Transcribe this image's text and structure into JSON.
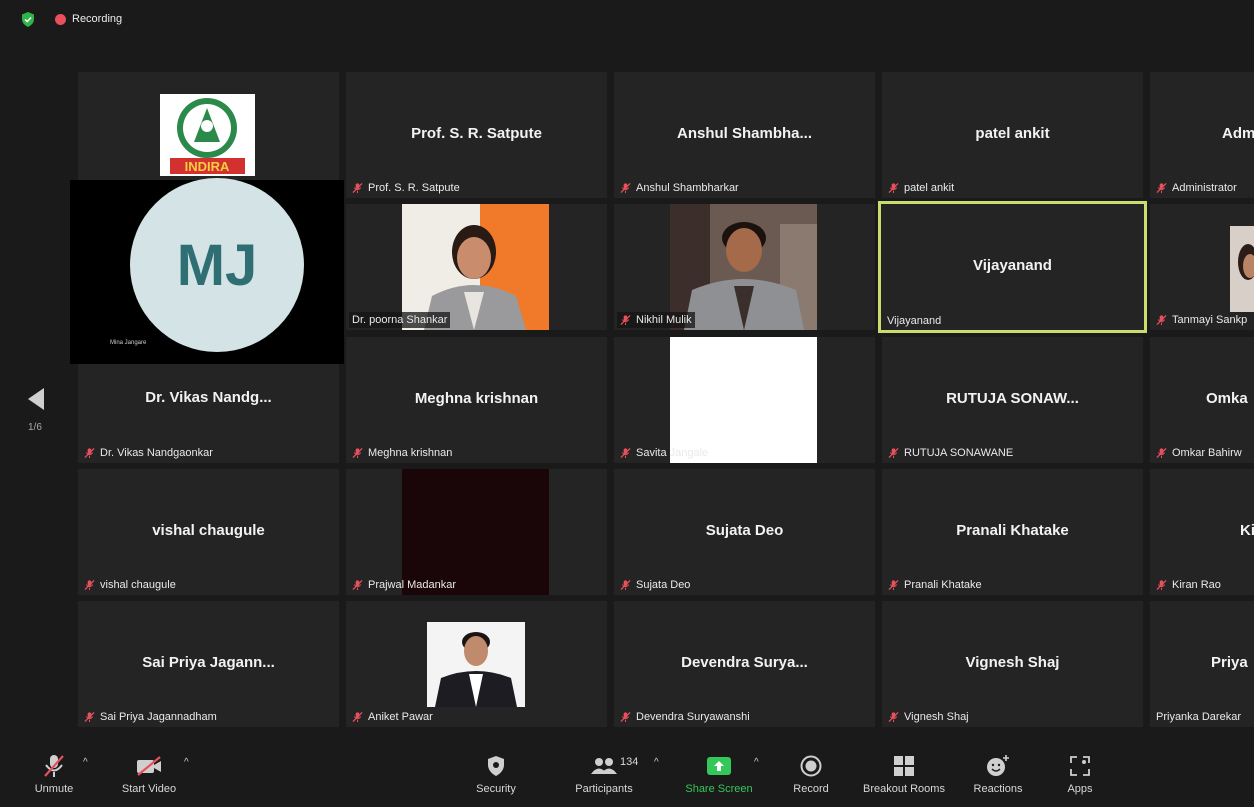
{
  "topbar": {
    "recording_label": "Recording"
  },
  "pager": {
    "page_label": "1/6"
  },
  "featured": {
    "initials": "MJ",
    "name": "Mina Jangare"
  },
  "tiles": [
    {
      "name": "Prof. S. R. Satpute",
      "label": "Prof. S. R. Satpute"
    },
    {
      "name": "Anshul  Shambha...",
      "label": "Anshul Shambharkar"
    },
    {
      "name": "patel ankit",
      "label": "patel ankit"
    },
    {
      "name": "Adm",
      "label": "Administrator"
    },
    {
      "name": "",
      "label": "Dr. poorna Shankar"
    },
    {
      "name": "",
      "label": "Nikhil Mulik"
    },
    {
      "name": "Vijayanand",
      "label": "Vijayanand"
    },
    {
      "name": "",
      "label": "Tanmayi Sankp"
    },
    {
      "name": "Dr. Vikas Nandg...",
      "label": "Dr. Vikas Nandgaonkar"
    },
    {
      "name": "Meghna krishnan",
      "label": "Meghna krishnan"
    },
    {
      "name": "",
      "label": "Savita Jangale"
    },
    {
      "name": "RUTUJA  SONAW...",
      "label": "RUTUJA SONAWANE"
    },
    {
      "name": "Omka",
      "label": "Omkar Bahirw"
    },
    {
      "name": "vishal chaugule",
      "label": "vishal chaugule"
    },
    {
      "name": "",
      "label": "Prajwal Madankar"
    },
    {
      "name": "Sujata Deo",
      "label": "Sujata Deo"
    },
    {
      "name": "Pranali Khatake",
      "label": "Pranali Khatake"
    },
    {
      "name": "Ki",
      "label": "Kiran Rao"
    },
    {
      "name": "Sai Priya Jagann...",
      "label": "Sai Priya Jagannadham"
    },
    {
      "name": "",
      "label": "Aniket Pawar"
    },
    {
      "name": "Devendra  Surya...",
      "label": "Devendra Suryawanshi"
    },
    {
      "name": "Vignesh Shaj",
      "label": "Vignesh Shaj"
    },
    {
      "name": "Priya",
      "label": "Priyanka Darekar"
    }
  ],
  "toolbar": {
    "unmute": "Unmute",
    "start_video": "Start Video",
    "security": "Security",
    "participants": "Participants",
    "participant_count": "134",
    "share_screen": "Share Screen",
    "record": "Record",
    "breakout_rooms": "Breakout Rooms",
    "reactions": "Reactions",
    "apps": "Apps"
  },
  "colors": {
    "background": "#1a1a1a",
    "tile": "#242424",
    "speaking_border": "#c9dd6e",
    "share_green": "#34c759",
    "muted_red": "#e8505b"
  }
}
